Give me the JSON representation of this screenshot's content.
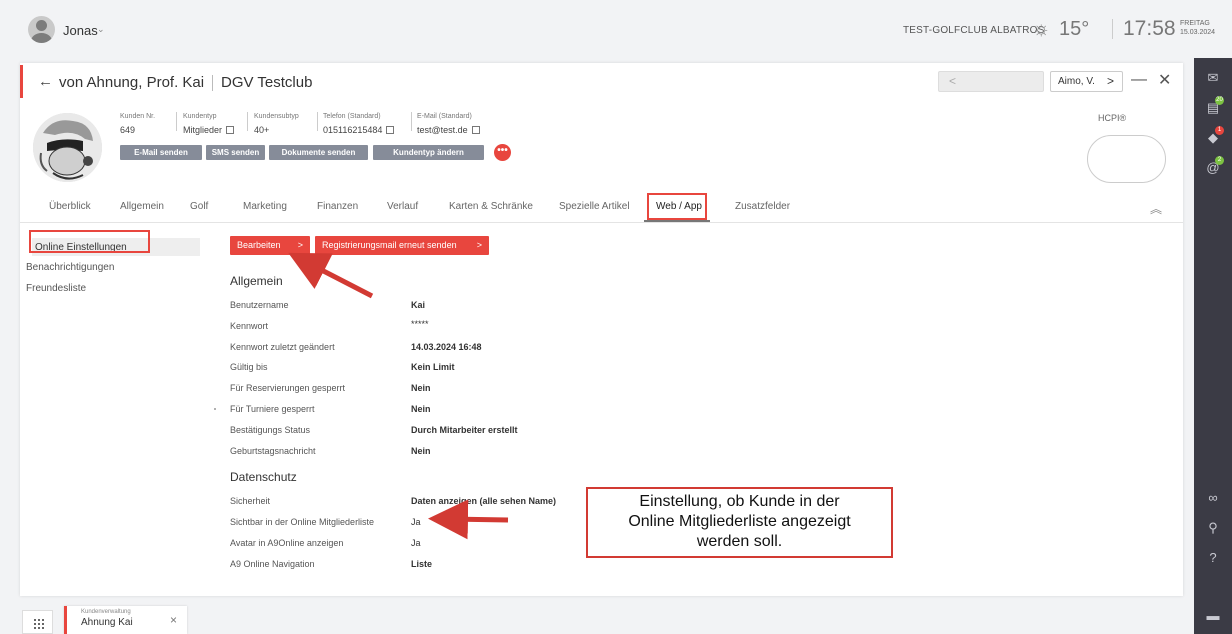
{
  "topbar": {
    "user": "Jonas",
    "user_caret": "⌄",
    "club": "TEST-GOLFCLUB ALBATROS",
    "temperature": "15°",
    "time": "17:58",
    "day": "FREITAG",
    "date": "15.03.2024"
  },
  "header": {
    "back": "←",
    "customer_name": "von Ahnung, Prof. Kai",
    "club": "DGV Testclub",
    "prev_nav": "<",
    "next_nav_label": "Aimo, V.",
    "next_nav_chevron": ">",
    "minimize": "—",
    "close": "✕"
  },
  "customer_info": {
    "nr_label": "Kunden Nr.",
    "nr": "649",
    "type_label": "Kundentyp",
    "type": "Mitglieder",
    "subtype_label": "Kundensubtyp",
    "subtype": "40+",
    "phone_label": "Telefon (Standard)",
    "phone": "015116215484",
    "email_label": "E-Mail (Standard)",
    "email": "test@test.de"
  },
  "actions": {
    "email": "E-Mail senden",
    "sms": "SMS senden",
    "docs": "Dokumente senden",
    "type_change": "Kundentyp ändern",
    "more": "•••"
  },
  "hcpi": {
    "label": "HCPI®"
  },
  "tabs": [
    "Überblick",
    "Allgemein",
    "Golf",
    "Marketing",
    "Finanzen",
    "Verlauf",
    "Karten & Schränke",
    "Spezielle Artikel",
    "Web / App",
    "Zusatzfelder"
  ],
  "collapse": "︽",
  "submenu": [
    "Online Einstellungen",
    "Benachrichtigungen",
    "Freundesliste"
  ],
  "buttons": {
    "edit": "Bearbeiten",
    "resend": "Registrierungsmail erneut senden",
    "chevron": ">"
  },
  "sections": {
    "general": "Allgemein",
    "privacy": "Datenschutz"
  },
  "general_rows": [
    {
      "label": "Benutzername",
      "value": "Kai"
    },
    {
      "label": "Kennwort",
      "value": "*****"
    },
    {
      "label": "Kennwort zuletzt geändert",
      "value": "14.03.2024 16:48"
    },
    {
      "label": "Gültig bis",
      "value": "Kein Limit"
    },
    {
      "label": "Für Reservierungen gesperrt",
      "value": "Nein"
    },
    {
      "label": "Für Turniere gesperrt",
      "value": "Nein"
    },
    {
      "label": "Bestätigungs Status",
      "value": "Durch Mitarbeiter erstellt"
    },
    {
      "label": "Geburtstagsnachricht",
      "value": "Nein"
    }
  ],
  "privacy_rows": [
    {
      "label": "Sicherheit",
      "value": "Daten anzeigen (alle sehen Name)"
    },
    {
      "label": "Sichtbar in der Online Mitgliederliste",
      "value": "Ja"
    },
    {
      "label": "Avatar in A9Online anzeigen",
      "value": "Ja"
    },
    {
      "label": "A9 Online Navigation",
      "value": "Liste"
    }
  ],
  "callout": {
    "line1": "Einstellung, ob Kunde in der",
    "line2": "Online Mitgliederliste angezeigt",
    "line3": "werden soll."
  },
  "taskbar": {
    "small": "Kundenverwaltung",
    "name": "Ahnung Kai",
    "close": "×"
  },
  "rightbar_badges": {
    "first": "20",
    "second": "1",
    "third": "2"
  },
  "colors": {
    "accent": "#e8463e",
    "rightbar": "#3b3b45",
    "action_button": "#868c99"
  }
}
